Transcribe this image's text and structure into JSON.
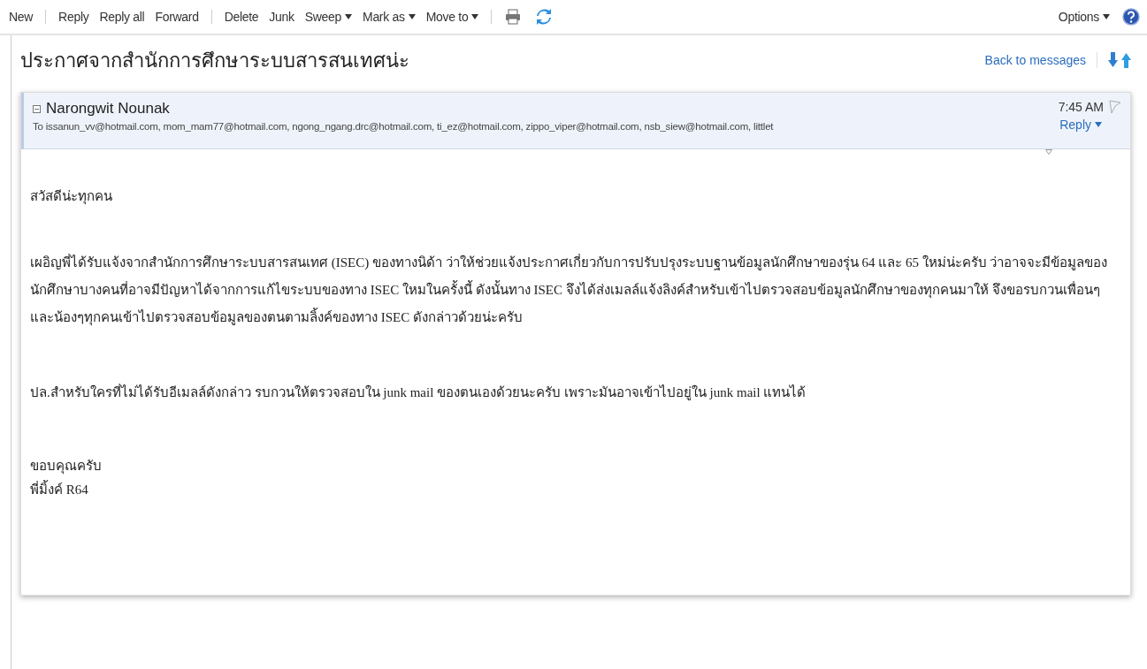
{
  "toolbar": {
    "groups": [
      [
        {
          "label": "New",
          "dropdown": false
        }
      ],
      [
        {
          "label": "Reply",
          "dropdown": false
        },
        {
          "label": "Reply all",
          "dropdown": false
        },
        {
          "label": "Forward",
          "dropdown": false
        }
      ],
      [
        {
          "label": "Delete",
          "dropdown": false
        },
        {
          "label": "Junk",
          "dropdown": false
        },
        {
          "label": "Sweep",
          "dropdown": true
        },
        {
          "label": "Mark as",
          "dropdown": true
        },
        {
          "label": "Move to",
          "dropdown": true
        }
      ]
    ],
    "options": {
      "label": "Options",
      "dropdown": true
    }
  },
  "message": {
    "subject": "ประกาศจากสำนักการศึกษาระบบสารสนเทศน่ะ",
    "back_link": "Back to messages",
    "sender": "Narongwit Nounak",
    "to": "To issanun_vv@hotmail.com, mom_mam77@hotmail.com, ngong_ngang.drc@hotmail.com, ti_ez@hotmail.com, zippo_viper@hotmail.com, nsb_siew@hotmail.com, littlet",
    "time": "7:45 AM",
    "flagged": false,
    "reply": "Reply",
    "body": [
      "สวัสดีน่ะทุกคน",
      "เผอิญพี่ได้รับแจ้งจากสำนักการศึกษาระบบสารสนเทศ (ISEC) ของทางนิด้า ว่าให้ช่วยแจ้งประกาศเกี่ยวกับการปรับปรุงระบบฐานข้อมูลนักศึกษาของรุ่น 64 และ 65 ใหม่น่ะครับ ว่าอาจจะมีข้อมูลของนักศึกษาบางคนที่อาจมีปัญหาได้จากการแก้ไขระบบของทาง ISEC ใหมในครั้งนี้ ดังนั้นทาง ISEC จึงได้ส่งเมลล์แจ้งลิงค์สำหรับเข้าไปตรวจสอบข้อมูลนักศึกษาของทุกคนมาให้ จึงขอรบกวนเพื่อนๆและน้องๆทุกคนเข้าไปตรวจสอบข้อมูลของตนตามลิ้งค์ของทาง ISEC ดังกล่าวด้วยน่ะครับ",
      "ปล.สำหรับใครที่ไม่ได้รับอีเมลล์ดังกล่าว รบกวนให้ตรวจสอบใน junk mail ของตนเองด้วยนะครับ เพราะมันอาจเข้าไปอยู่ใน junk mail แทนได้"
    ],
    "signature": [
      "ขอบคุณครับ",
      "พี่มิ้งค์ R64"
    ]
  }
}
